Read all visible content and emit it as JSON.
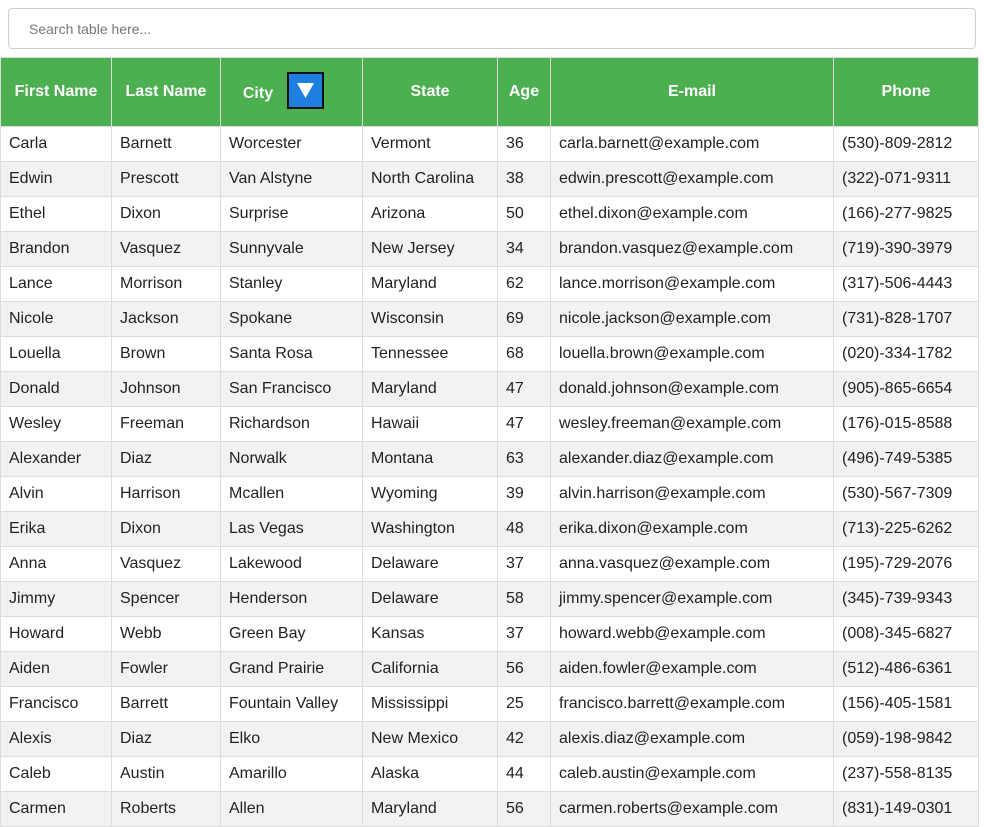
{
  "search": {
    "placeholder": "Search table here..."
  },
  "colors": {
    "header_bg": "#4caf50",
    "filter_button_bg": "#1f7fe0"
  },
  "table": {
    "headers": [
      "First Name",
      "Last Name",
      "City",
      "State",
      "Age",
      "E-mail",
      "Phone"
    ],
    "filter_icon": "triangle-down-icon",
    "rows": [
      [
        "Carla",
        "Barnett",
        "Worcester",
        "Vermont",
        "36",
        "carla.barnett@example.com",
        "(530)-809-2812"
      ],
      [
        "Edwin",
        "Prescott",
        "Van Alstyne",
        "North Carolina",
        "38",
        "edwin.prescott@example.com",
        "(322)-071-9311"
      ],
      [
        "Ethel",
        "Dixon",
        "Surprise",
        "Arizona",
        "50",
        "ethel.dixon@example.com",
        "(166)-277-9825"
      ],
      [
        "Brandon",
        "Vasquez",
        "Sunnyvale",
        "New Jersey",
        "34",
        "brandon.vasquez@example.com",
        "(719)-390-3979"
      ],
      [
        "Lance",
        "Morrison",
        "Stanley",
        "Maryland",
        "62",
        "lance.morrison@example.com",
        "(317)-506-4443"
      ],
      [
        "Nicole",
        "Jackson",
        "Spokane",
        "Wisconsin",
        "69",
        "nicole.jackson@example.com",
        "(731)-828-1707"
      ],
      [
        "Louella",
        "Brown",
        "Santa Rosa",
        "Tennessee",
        "68",
        "louella.brown@example.com",
        "(020)-334-1782"
      ],
      [
        "Donald",
        "Johnson",
        "San Francisco",
        "Maryland",
        "47",
        "donald.johnson@example.com",
        "(905)-865-6654"
      ],
      [
        "Wesley",
        "Freeman",
        "Richardson",
        "Hawaii",
        "47",
        "wesley.freeman@example.com",
        "(176)-015-8588"
      ],
      [
        "Alexander",
        "Diaz",
        "Norwalk",
        "Montana",
        "63",
        "alexander.diaz@example.com",
        "(496)-749-5385"
      ],
      [
        "Alvin",
        "Harrison",
        "Mcallen",
        "Wyoming",
        "39",
        "alvin.harrison@example.com",
        "(530)-567-7309"
      ],
      [
        "Erika",
        "Dixon",
        "Las Vegas",
        "Washington",
        "48",
        "erika.dixon@example.com",
        "(713)-225-6262"
      ],
      [
        "Anna",
        "Vasquez",
        "Lakewood",
        "Delaware",
        "37",
        "anna.vasquez@example.com",
        "(195)-729-2076"
      ],
      [
        "Jimmy",
        "Spencer",
        "Henderson",
        "Delaware",
        "58",
        "jimmy.spencer@example.com",
        "(345)-739-9343"
      ],
      [
        "Howard",
        "Webb",
        "Green Bay",
        "Kansas",
        "37",
        "howard.webb@example.com",
        "(008)-345-6827"
      ],
      [
        "Aiden",
        "Fowler",
        "Grand Prairie",
        "California",
        "56",
        "aiden.fowler@example.com",
        "(512)-486-6361"
      ],
      [
        "Francisco",
        "Barrett",
        "Fountain Valley",
        "Mississippi",
        "25",
        "francisco.barrett@example.com",
        "(156)-405-1581"
      ],
      [
        "Alexis",
        "Diaz",
        "Elko",
        "New Mexico",
        "42",
        "alexis.diaz@example.com",
        "(059)-198-9842"
      ],
      [
        "Caleb",
        "Austin",
        "Amarillo",
        "Alaska",
        "44",
        "caleb.austin@example.com",
        "(237)-558-8135"
      ],
      [
        "Carmen",
        "Roberts",
        "Allen",
        "Maryland",
        "56",
        "carmen.roberts@example.com",
        "(831)-149-0301"
      ]
    ]
  }
}
